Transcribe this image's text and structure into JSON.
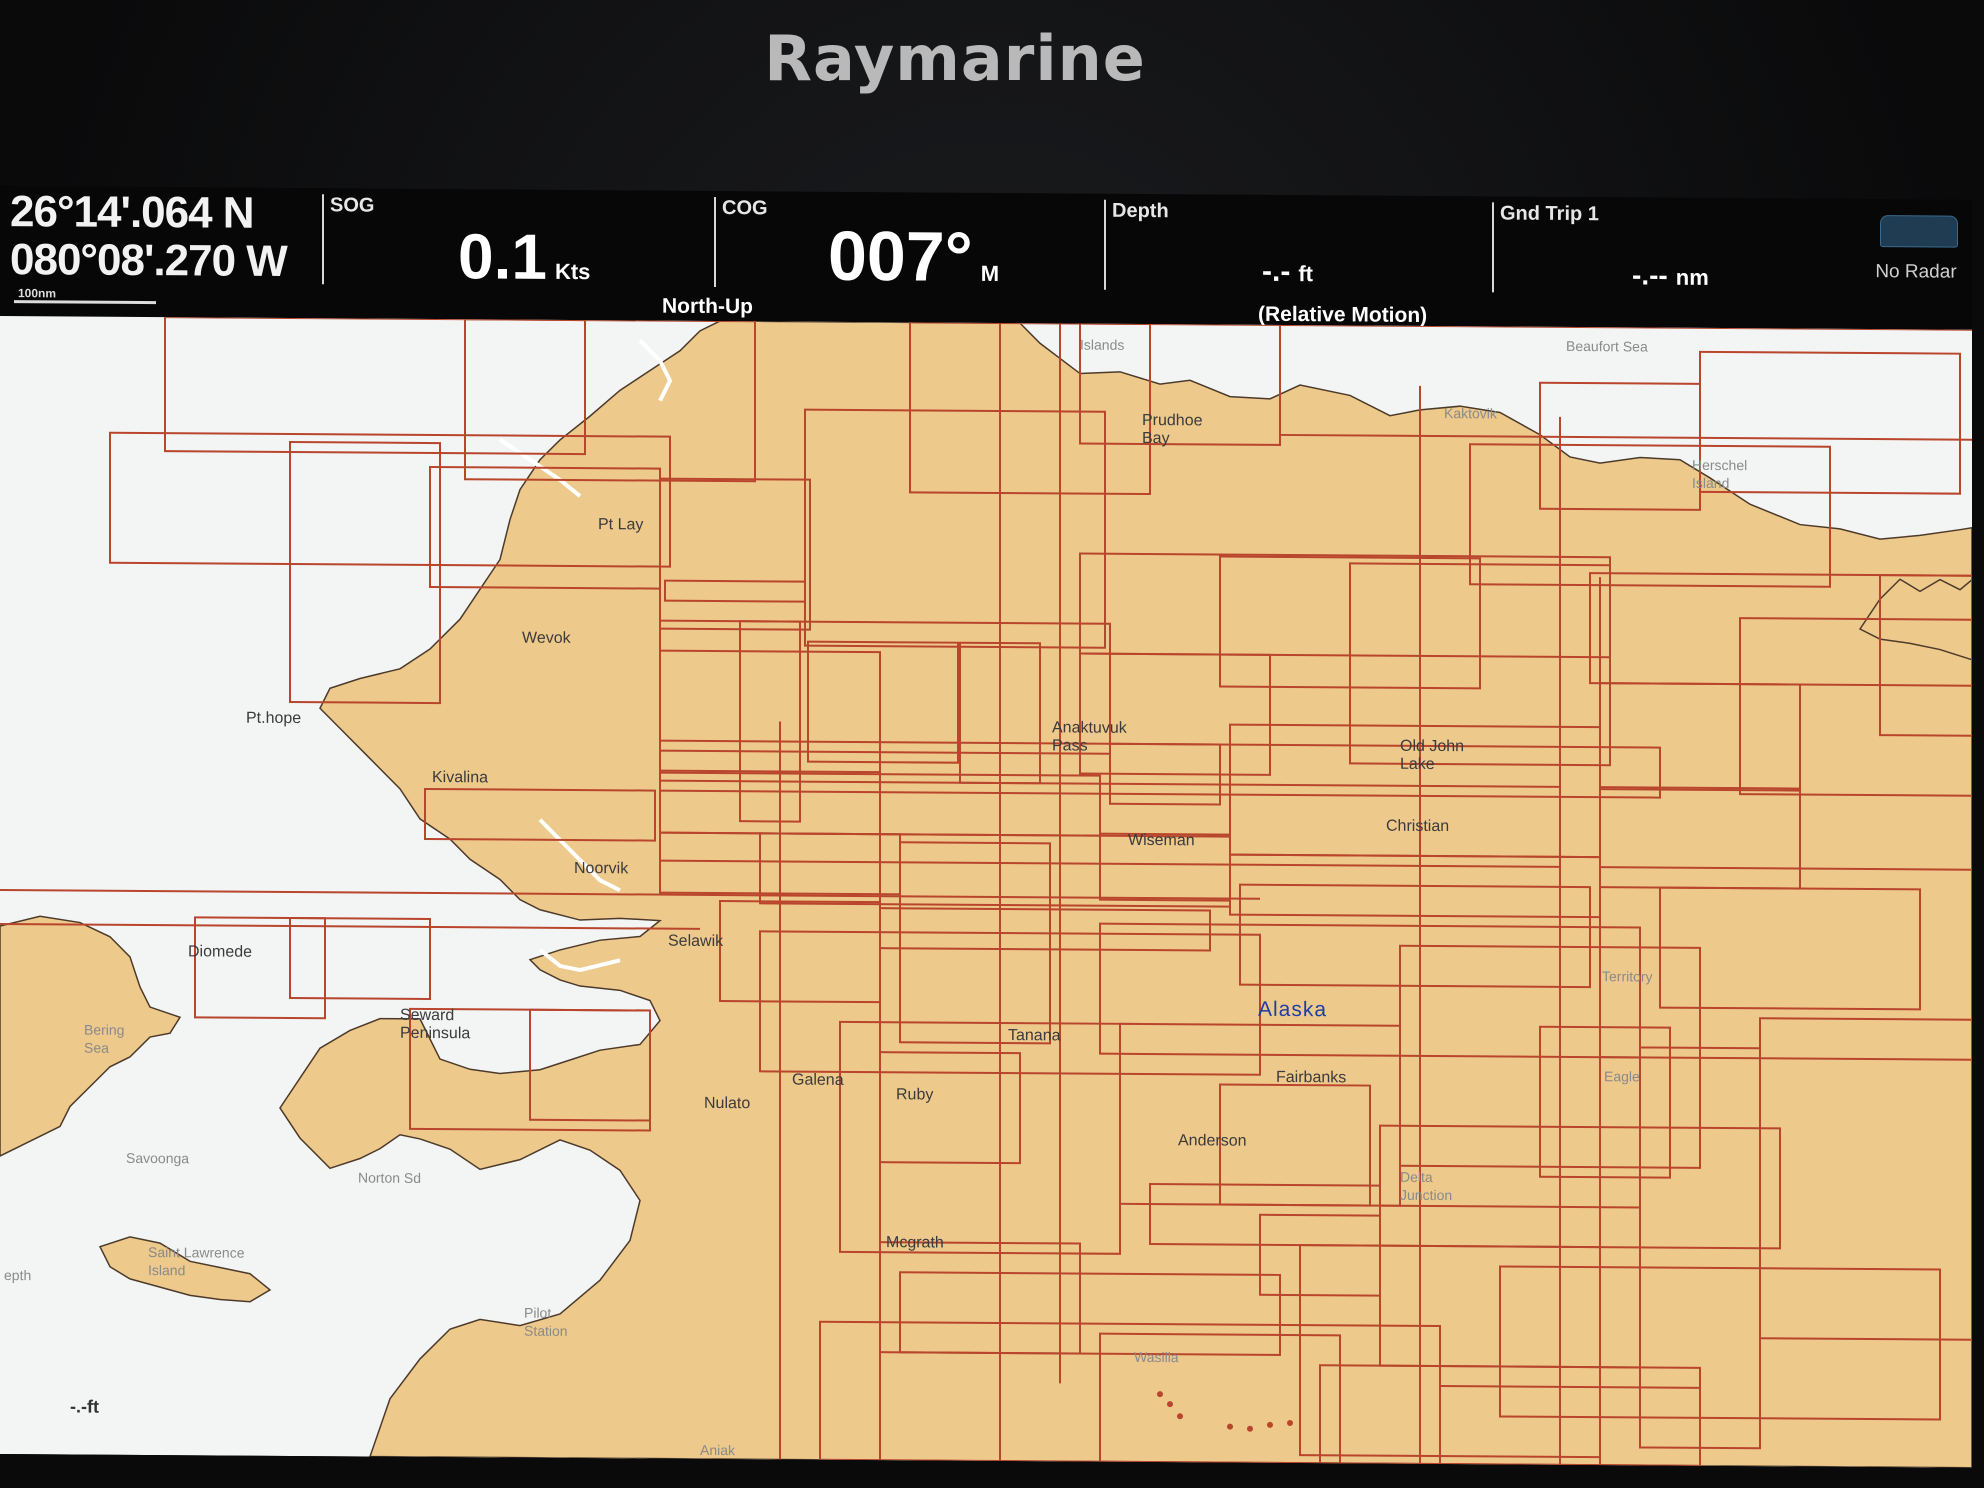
{
  "device": {
    "brand": "Raymarine"
  },
  "databar": {
    "position": {
      "lat": "26°14'.064 N",
      "lon": "080°08'.270 W"
    },
    "scale": "100nm",
    "sog": {
      "label": "SOG",
      "value": "0.1",
      "unit": "Kts"
    },
    "cog": {
      "label": "COG",
      "value": "007°",
      "unit": "M"
    },
    "depth": {
      "label": "Depth",
      "value": "-.-",
      "unit": "ft"
    },
    "gnd_trip": {
      "label": "Gnd Trip 1",
      "value": "-.--",
      "unit": "nm"
    },
    "orientation": "North-Up",
    "motion_mode": "(Relative Motion)",
    "radar_status": "No Radar"
  },
  "chart": {
    "places": {
      "pt_lay": "Pt Lay",
      "islands": "Islands",
      "prudhoe": "Prudhoe\nBay",
      "kaktovik": "Kaktovik",
      "beaufort": "Beaufort Sea",
      "herschel": "Herschel\nIsland",
      "wevok": "Wevok",
      "pt_hope": "Pt.hope",
      "kivalina": "Kivalina",
      "anaktuvuk": "Anaktuvuk\nPass",
      "old_john": "Old John\nLake",
      "christian": "Christian",
      "wiseman": "Wiseman",
      "noorvik": "Noorvik",
      "selawik": "Selawik",
      "diomede": "Diomede",
      "bering_sea": "Bering\nSea",
      "seward": "Seward\nPeninsula",
      "tanana": "Tanana",
      "alaska": "Alaska",
      "territory": "Territory",
      "galena": "Galena",
      "nulato": "Nulato",
      "ruby": "Ruby",
      "fairbanks": "Fairbanks",
      "eagle": "Eagle",
      "anderson": "Anderson",
      "savoonga": "Savoonga",
      "norton_sd": "Norton Sd",
      "delta": "Delta\nJunction",
      "st_lawrence": "Saint Lawrence\nIsland",
      "mcgrath": "Mcgrath",
      "pilot": "Pilot\nStation",
      "wasilla": "Wasilla",
      "aniak": "Aniak",
      "depth_side": "epth"
    },
    "depth_readout": "-.-ft",
    "colors": {
      "land": "#eec98c",
      "sea": "#f3f5f4",
      "cell_border": "#b8452c",
      "accent_blue": "#1d3ea7"
    }
  }
}
